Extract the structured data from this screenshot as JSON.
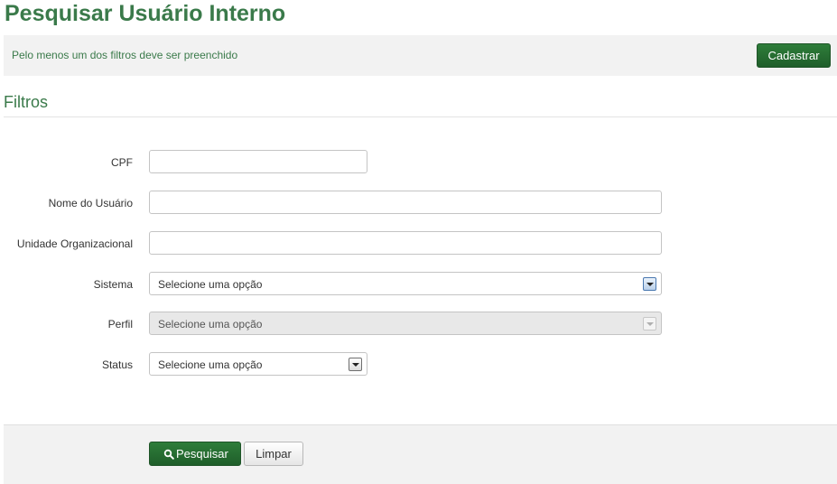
{
  "header": {
    "title": "Pesquisar Usuário Interno"
  },
  "alert": {
    "message": "Pelo menos um dos filtros deve ser preenchido",
    "register_label": "Cadastrar"
  },
  "filters": {
    "section_title": "Filtros",
    "cpf": {
      "label": "CPF",
      "value": ""
    },
    "nome_usuario": {
      "label": "Nome do Usuário",
      "value": ""
    },
    "unidade_organizacional": {
      "label": "Unidade Organizacional",
      "value": ""
    },
    "sistema": {
      "label": "Sistema",
      "selected": "Selecione uma opção"
    },
    "perfil": {
      "label": "Perfil",
      "selected": "Selecione uma opção",
      "disabled": true
    },
    "status": {
      "label": "Status",
      "selected": "Selecione uma opção"
    }
  },
  "actions": {
    "search_label": "Pesquisar",
    "clear_label": "Limpar"
  },
  "colors": {
    "brand_green": "#3a7a4a",
    "button_green": "#26703a",
    "panel_gray": "#f2f2f2"
  },
  "icons": {
    "search_button_icon": "search-icon",
    "select_arrow_icon": "chevron-down-icon"
  }
}
